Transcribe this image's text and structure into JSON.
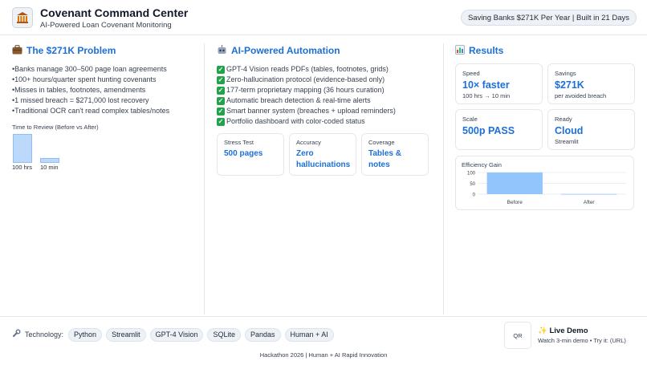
{
  "header": {
    "logo_icon": "bank-building-icon",
    "title": "Covenant Command Center",
    "subtitle": "AI-Powered Loan Covenant Monitoring",
    "badge": "Saving Banks $271K Per Year | Built in 21 Days"
  },
  "problem": {
    "icon": "briefcase-icon",
    "title": "The $271K Problem",
    "bullets": [
      "Banks manage 300–500 page loan agreements",
      "100+ hours/quarter spent hunting covenants",
      "Misses in tables, footnotes, amendments",
      "1 missed breach = $271,000 lost recovery",
      "Traditional OCR can't read complex tables/notes"
    ],
    "chart_label": "Time to Review (Before vs After)",
    "bar_labels": [
      "100 hrs",
      "10 min"
    ]
  },
  "automation": {
    "icon": "robot-icon",
    "title": "AI-Powered Automation",
    "check_icon": "check-box-icon",
    "checks": [
      "GPT-4 Vision reads PDFs (tables, footnotes, grids)",
      "Zero-hallucination protocol (evidence-based only)",
      "177-term proprietary mapping (36 hours curation)",
      "Automatic breach detection & real-time alerts",
      "Smart banner system (breaches + upload reminders)",
      "Portfolio dashboard with color-coded status"
    ],
    "cards": [
      {
        "label": "Stress Test",
        "value": "500 pages"
      },
      {
        "label": "Accuracy",
        "value": "Zero hallucinations"
      },
      {
        "label": "Coverage",
        "value": "Tables & notes"
      }
    ]
  },
  "results": {
    "icon": "bar-chart-icon",
    "title": "Results",
    "stats": [
      {
        "label": "Speed",
        "value": "10× faster",
        "sub": "100 hrs → 10 min"
      },
      {
        "label": "Savings",
        "value": "$271K",
        "sub": "per avoided breach"
      },
      {
        "label": "Scale",
        "value": "500p PASS",
        "sub": ""
      },
      {
        "label": "Ready",
        "value": "Cloud",
        "sub": "Streamlit"
      }
    ],
    "efficiency_label": "Efficiency Gain"
  },
  "chart_data": [
    {
      "type": "bar",
      "title": "Time to Review (Before vs After)",
      "categories": [
        "100 hrs",
        "10 min"
      ],
      "values": [
        100,
        0.17
      ],
      "xlabel": "",
      "ylabel": ""
    },
    {
      "type": "bar",
      "title": "Efficiency Gain",
      "categories": [
        "Before",
        "After"
      ],
      "values": [
        100,
        1
      ],
      "yticks": [
        0,
        50,
        100
      ],
      "ylim": [
        0,
        100
      ],
      "grid": true,
      "bar_color": "#93c5fd"
    }
  ],
  "footer": {
    "tech_icon": "wrench-icon",
    "tech_label": "Technology:",
    "tech": [
      "Python",
      "Streamlit",
      "GPT-4 Vision",
      "SQLite",
      "Pandas",
      "Human + AI"
    ],
    "qr_label": "QR",
    "live_icon": "sparkles-icon",
    "live_title": "Live Demo",
    "live_sub": "Watch 3-min demo • Try it: (URL)",
    "copyright": "Hackathon 2026 | Human + AI Rapid Innovation"
  },
  "colors": {
    "accent": "#1d6fd8",
    "bar_fill": "#bcd9fb",
    "check_green": "#22a24a"
  }
}
